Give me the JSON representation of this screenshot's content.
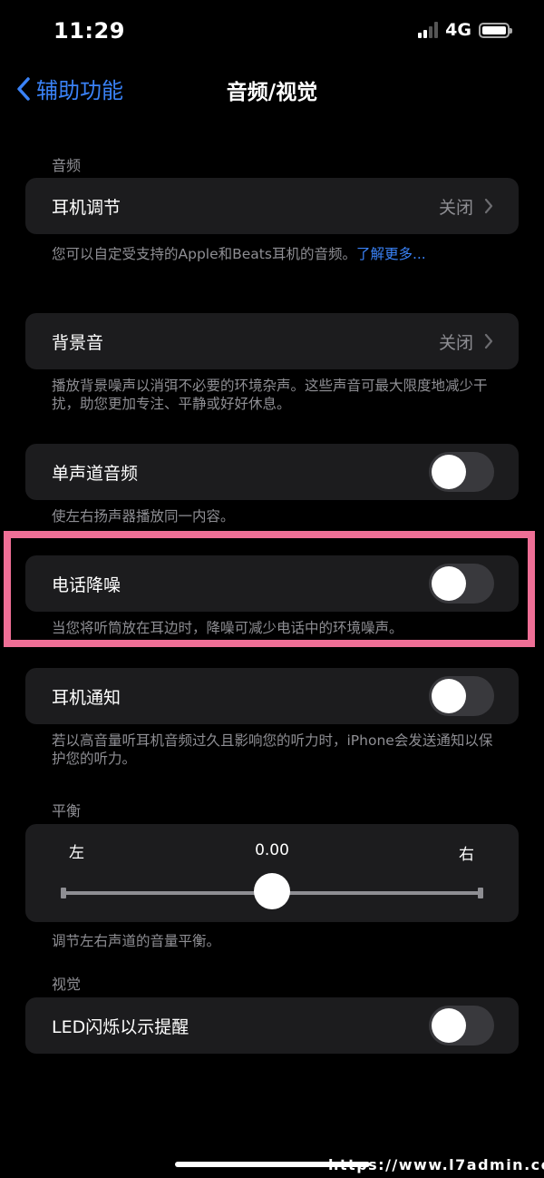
{
  "status_bar": {
    "time": "11:29",
    "network": "4G"
  },
  "nav": {
    "back_label": "辅助功能",
    "title": "音频/视觉"
  },
  "audio": {
    "section_label": "音频",
    "headphone": {
      "label": "耳机调节",
      "value": "关闭"
    },
    "headphone_footnote": "您可以自定受支持的Apple和Beats耳机的音频。",
    "headphone_footnote_link": "了解更多...",
    "background": {
      "label": "背景音",
      "value": "关闭"
    },
    "background_footnote": "播放背景噪声以消弭不必要的环境杂声。这些声音可最大限度地减少干扰，助您更加专注、平静或好好休息。",
    "mono": {
      "label": "单声道音频",
      "on": false
    },
    "mono_footnote": "使左右扬声器播放同一内容。",
    "noise": {
      "label": "电话降噪",
      "on": false
    },
    "noise_footnote": "当您将听筒放在耳边时，降噪可减少电话中的环境噪声。",
    "notify": {
      "label": "耳机通知",
      "on": false
    },
    "notify_footnote": "若以高音量听耳机音频过久且影响您的听力时，iPhone会发送通知以保护您的听力。"
  },
  "balance": {
    "section_label": "平衡",
    "left_label": "左",
    "right_label": "右",
    "value_text": "0.00",
    "value": 0.0,
    "footnote": "调节左右声道的音量平衡。"
  },
  "visual": {
    "section_label": "视觉",
    "led": {
      "label": "LED闪烁以示提醒",
      "on": false
    }
  },
  "watermark": "https://www.l7admin.cc",
  "colors": {
    "accent": "#3a82f7",
    "highlight": "#ef6f96",
    "cell": "#1c1c1e",
    "secondary": "#8e8e93"
  }
}
